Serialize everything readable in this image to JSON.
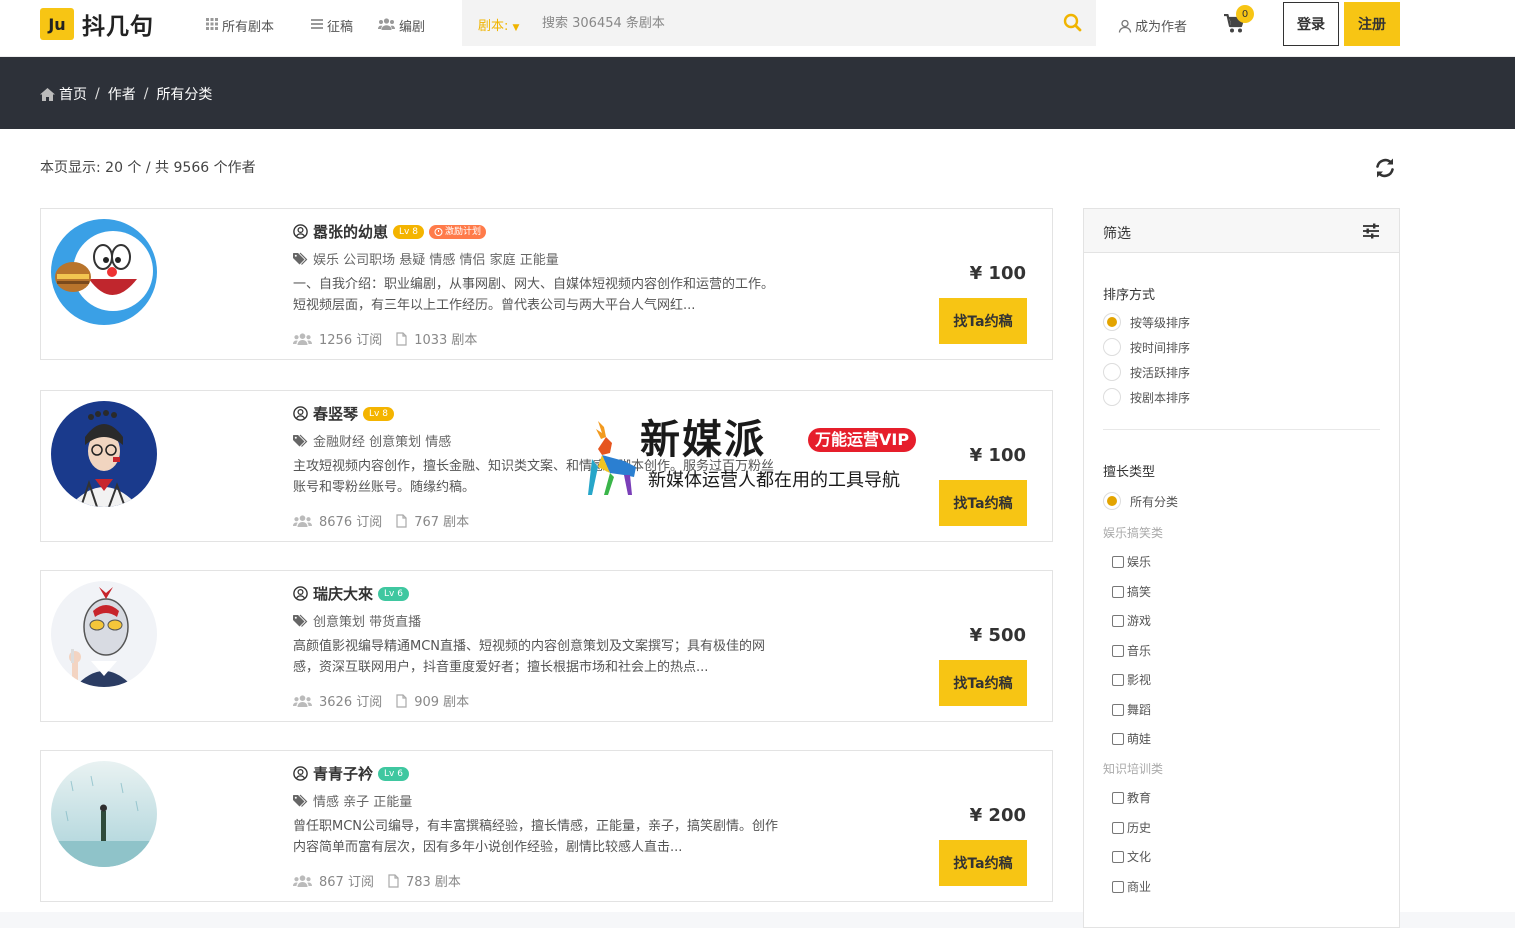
{
  "brand": {
    "logo_mark": "Ju",
    "logo_text": "抖几句"
  },
  "nav": {
    "items": [
      {
        "label": "所有剧本",
        "icon": "grid-icon"
      },
      {
        "label": "征稿",
        "icon": "list-icon"
      },
      {
        "label": "编剧",
        "icon": "users-icon"
      }
    ],
    "search_category": "剧本:",
    "search_placeholder": "搜索 306454 条剧本",
    "become_author": "成为作者",
    "cart_count": "0",
    "login": "登录",
    "register": "注册"
  },
  "breadcrumb": [
    "首页",
    "作者",
    "所有分类"
  ],
  "breadcrumb_sep": "/",
  "summary": "本页显示: 20 个 / 共 9566 个作者",
  "authors": [
    {
      "name": "嚣张的幼崽",
      "level": "Lv 8",
      "plan": "激励计划",
      "tags": "娱乐 公司职场 悬疑 情感 情侣 家庭 正能量",
      "desc": "一、自我介绍：职业编剧，从事网剧、网大、自媒体短视频内容创作和运营的工作。短视频层面，有三年以上工作经历。曾代表公司与两大平台人气网红...",
      "subscribers": "1256 订阅",
      "scripts": "1033 剧本",
      "price": "¥ 100",
      "button": "找Ta约稿"
    },
    {
      "name": "春竖琴",
      "level": "Lv 8",
      "plan": "",
      "tags": "金融财经 创意策划 情感",
      "desc": "主攻短视频内容创作，擅长金融、知识类文案、和情感类脚本创作。服务过百万粉丝账号和零粉丝账号。随缘约稿。",
      "subscribers": "8676 订阅",
      "scripts": "767 剧本",
      "price": "¥ 100",
      "button": "找Ta约稿"
    },
    {
      "name": "瑞庆大來",
      "level": "Lv 6",
      "plan": "",
      "tags": "创意策划 带货直播",
      "desc": "高颜值影视编导精通MCN直播、短视频的内容创意策划及文案撰写；具有极佳的网感，资深互联网用户，抖音重度爱好者；擅长根据市场和社会上的热点...",
      "subscribers": "3626 订阅",
      "scripts": "909 剧本",
      "price": "¥ 500",
      "button": "找Ta约稿"
    },
    {
      "name": "青青子衿",
      "level": "Lv 6",
      "plan": "",
      "tags": "情感 亲子 正能量",
      "desc": "曾任职MCN公司编导，有丰富撰稿经验，擅长情感，正能量，亲子，搞笑剧情。创作内容简单而富有层次，因有多年小说创作经验，剧情比较感人直击...",
      "subscribers": "867 订阅",
      "scripts": "783 剧本",
      "price": "¥ 200",
      "button": "找Ta约稿"
    }
  ],
  "filter": {
    "title": "筛选",
    "sort_title": "排序方式",
    "sort_options": [
      "按等级排序",
      "按时间排序",
      "按活跃排序",
      "按剧本排序"
    ],
    "sort_selected": 0,
    "type_title": "擅长类型",
    "all_label": "所有分类",
    "groups": [
      {
        "label": "娱乐搞笑类",
        "items": [
          "娱乐",
          "搞笑",
          "游戏",
          "音乐",
          "影视",
          "舞蹈",
          "萌娃"
        ]
      },
      {
        "label": "知识培训类",
        "items": [
          "教育",
          "历史",
          "文化",
          "商业"
        ]
      }
    ]
  },
  "watermark": {
    "title": "新媒派",
    "vip": "万能运营VIP",
    "subtitle": "新媒体运营人都在用的工具导航"
  },
  "colors": {
    "accent": "#f7c514",
    "dark_bar": "#2d3139",
    "lv8": "#f4b400",
    "lv6": "#3fc7a0",
    "plan": "#ff7b4a"
  }
}
